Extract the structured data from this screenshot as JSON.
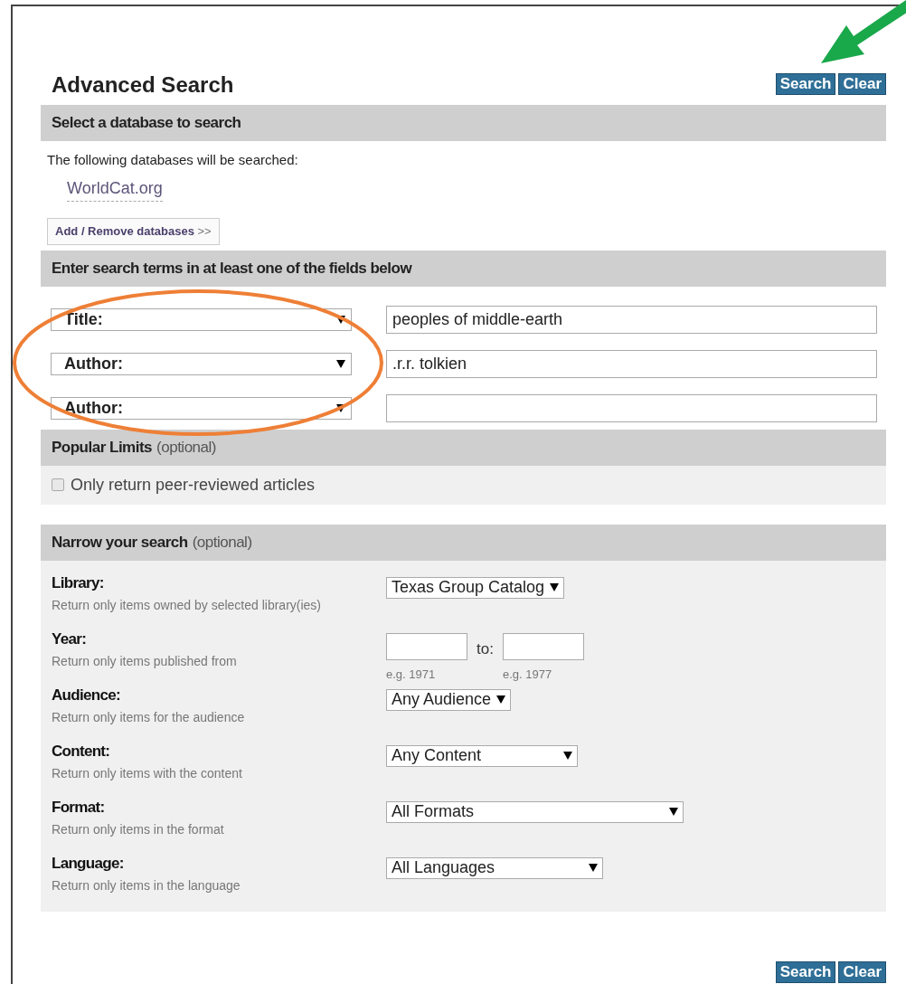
{
  "header": {
    "title": "Advanced Search",
    "buttons": [
      {
        "label": "Search"
      },
      {
        "label": "Clear"
      }
    ]
  },
  "database_section": {
    "heading": "Select a database to search",
    "note": "The following databases will be searched:",
    "databases": [
      "WorldCat.org"
    ],
    "add_button": {
      "label": "Add / Remove databases",
      "chevron": ">>"
    }
  },
  "terms_section": {
    "heading": "Enter search terms in at least one of the fields below",
    "rows": [
      {
        "field": "Title:",
        "value": "peoples of middle-earth"
      },
      {
        "field": "Author:",
        "value": ".r.r. tolkien"
      },
      {
        "field": "Author:",
        "value": ""
      }
    ]
  },
  "popular_limits": {
    "heading": "Popular Limits",
    "note": "(optional)",
    "options": [
      {
        "label": "Only return peer-reviewed articles",
        "checked": false
      }
    ]
  },
  "narrow_section": {
    "heading": "Narrow your search",
    "note": "(optional)",
    "rows": [
      {
        "kind": "select",
        "label": "Library:",
        "hint": "Return only items owned by selected library(ies)",
        "value": "Texas Group Catalog"
      },
      {
        "kind": "range",
        "label": "Year:",
        "hint": "Return only items published from",
        "separator": "to:",
        "from_example": "e.g. 1971",
        "to_example": "e.g. 1977"
      },
      {
        "kind": "select",
        "label": "Audience:",
        "hint": "Return only items for the audience",
        "value": "Any Audience"
      },
      {
        "kind": "select",
        "label": "Content:",
        "hint": "Return only items with the content",
        "value": "Any Content"
      },
      {
        "kind": "select",
        "label": "Format:",
        "hint": "Return only items in the format",
        "value": "All Formats"
      },
      {
        "kind": "select",
        "label": "Language:",
        "hint": "Return only items in the language",
        "value": "All Languages"
      }
    ]
  },
  "footer": {
    "buttons": [
      {
        "label": "Search"
      },
      {
        "label": "Clear"
      }
    ]
  }
}
